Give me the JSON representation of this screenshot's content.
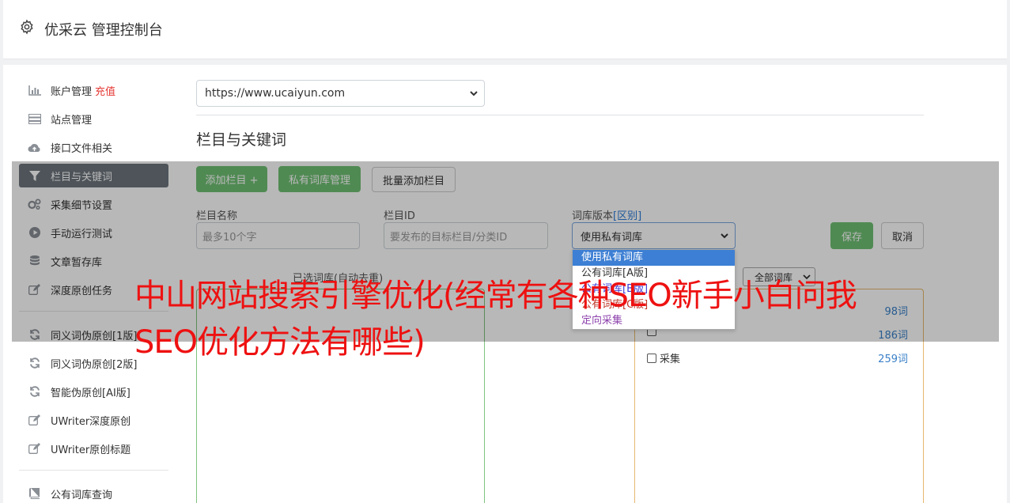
{
  "header": {
    "title": "优采云 管理控制台",
    "icon": "gear-icon"
  },
  "sidebar": {
    "items": [
      {
        "label": "账户管理",
        "badge": "充值",
        "icon": "bar-chart-icon"
      },
      {
        "label": "站点管理",
        "icon": "server-icon"
      },
      {
        "label": "接口文件相关",
        "icon": "cloud-upload-icon"
      },
      {
        "label": "栏目与关键词",
        "icon": "filter-icon",
        "active": true
      },
      {
        "label": "采集细节设置",
        "icon": "cogs-icon"
      },
      {
        "label": "手动运行测试",
        "icon": "play-circle-icon"
      },
      {
        "label": "文章暂存库",
        "icon": "database-icon"
      },
      {
        "label": "深度原创任务",
        "icon": "edit-icon"
      },
      {
        "label": "同义词伪原创[1版]",
        "icon": "refresh-icon"
      },
      {
        "label": "同义词伪原创[2版]",
        "icon": "refresh-icon"
      },
      {
        "label": "智能伪原创[AI版]",
        "icon": "refresh-icon"
      },
      {
        "label": "UWriter深度原创",
        "icon": "edit-icon"
      },
      {
        "label": "UWriter原创标题",
        "icon": "edit-icon"
      },
      {
        "label": "公有词库查询",
        "icon": "book-icon"
      }
    ]
  },
  "main": {
    "site_select": "https://www.ucaiyun.com",
    "section_title": "栏目与关键词",
    "buttons": {
      "add_column": "添加栏目 +",
      "private_lib": "私有词库管理",
      "batch_add": "批量添加栏目",
      "save": "保存",
      "cancel": "取消"
    },
    "form": {
      "name_label": "栏目名称",
      "name_placeholder": "最多10个字",
      "id_label": "栏目ID",
      "id_placeholder": "要发布的目标栏目/分类ID",
      "version_label": "词库版本",
      "version_link": "[区别]",
      "version_value": "使用私有词库"
    },
    "dropdown_options": [
      {
        "label": "使用私有词库",
        "color": "#ffffff",
        "selected": true
      },
      {
        "label": "公有词库[A版]",
        "color": "#333333"
      },
      {
        "label": "公有词库[B版]",
        "color": "#3b3bd6"
      },
      {
        "label": "公有词库[C版]",
        "color": "#c0392b"
      },
      {
        "label": "定向采集",
        "color": "#8e44ad"
      }
    ],
    "selected_panel_label": "已选词库(自动去重)",
    "filter_select": "全部词库",
    "library_rows": [
      {
        "label": "",
        "count": "98词"
      },
      {
        "label": "",
        "count": "186词"
      },
      {
        "label": "采集",
        "count": "259词"
      }
    ]
  },
  "overlay_headline": "中山网站搜索引擎优化(经常有各种SEO新手小白问我SEO优化方法有哪些)"
}
